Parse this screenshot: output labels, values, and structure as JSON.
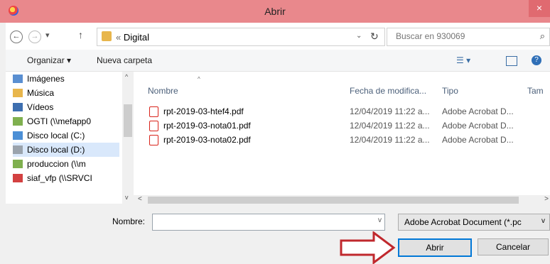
{
  "window": {
    "title": "Abrir",
    "close_glyph": "×"
  },
  "address": {
    "back": "←",
    "forward": "→",
    "history": "▾",
    "up": "↑",
    "prefix": "«",
    "path": "Digital",
    "dropdown": "⌄",
    "refresh": "↻",
    "search_placeholder": "Buscar en 930069",
    "search_glyph": "⌕"
  },
  "toolbar": {
    "organize": "Organizar ▾",
    "new_folder": "Nueva carpeta",
    "view_glyph": "☰ ▾",
    "help_glyph": "?"
  },
  "nav": {
    "items": [
      {
        "label": "Imágenes",
        "icon": "pictures-icon",
        "color": "#5a8fd1"
      },
      {
        "label": "Música",
        "icon": "music-icon",
        "color": "#e8b64c"
      },
      {
        "label": "Vídeos",
        "icon": "videos-icon",
        "color": "#3e6fb0"
      },
      {
        "label": "OGTI (\\\\mefapp0",
        "icon": "network-drive-icon",
        "color": "#7fb04f"
      },
      {
        "label": "Disco local (C:)",
        "icon": "windows-drive-icon",
        "color": "#4b8fd6"
      },
      {
        "label": "Disco local (D:)",
        "icon": "drive-icon",
        "color": "#9aa3ad"
      },
      {
        "label": "produccion (\\\\m",
        "icon": "network-drive-icon",
        "color": "#7fb04f"
      },
      {
        "label": "siaf_vfp (\\\\SRVCI",
        "icon": "disconnected-drive-icon",
        "color": "#d34141"
      }
    ],
    "selected_index": 5
  },
  "file_list": {
    "headers": {
      "name": "Nombre",
      "date": "Fecha de modifica...",
      "type": "Tipo",
      "size": "Tam"
    },
    "rows": [
      {
        "name": "rpt-2019-03-htef4.pdf",
        "date": "12/04/2019 11:22 a...",
        "type": "Adobe Acrobat D..."
      },
      {
        "name": "rpt-2019-03-nota01.pdf",
        "date": "12/04/2019 11:22 a...",
        "type": "Adobe Acrobat D..."
      },
      {
        "name": "rpt-2019-03-nota02.pdf",
        "date": "12/04/2019 11:22 a...",
        "type": "Adobe Acrobat D..."
      }
    ]
  },
  "bottom": {
    "name_label": "Nombre:",
    "name_value": "",
    "filetype_value": "Adobe Acrobat Document (*.pc",
    "open_label": "Abrir",
    "cancel_label": "Cancelar"
  },
  "colors": {
    "titlebar": "#e9888c",
    "arrow": "#c0282d",
    "selection": "#d9e8fb"
  }
}
